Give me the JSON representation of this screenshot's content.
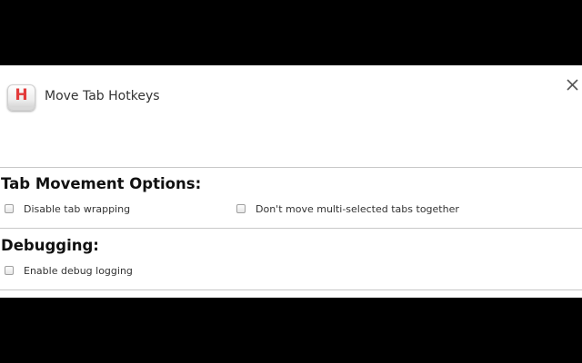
{
  "header": {
    "app_title": "Move Tab Hotkeys",
    "app_icon": "keycap-h-icon",
    "app_icon_letter": "H",
    "close_icon": "close-icon"
  },
  "sections": [
    {
      "title": "Tab Movement Options:",
      "options": [
        {
          "label": "Disable tab wrapping",
          "checked": false
        },
        {
          "label": "Don't move multi-selected tabs together",
          "checked": false
        }
      ]
    },
    {
      "title": "Debugging:",
      "options": [
        {
          "label": "Enable debug logging",
          "checked": false
        }
      ]
    }
  ],
  "colors": {
    "icon_letter": "#e23a3a",
    "background": "#000000",
    "panel": "#ffffff"
  }
}
